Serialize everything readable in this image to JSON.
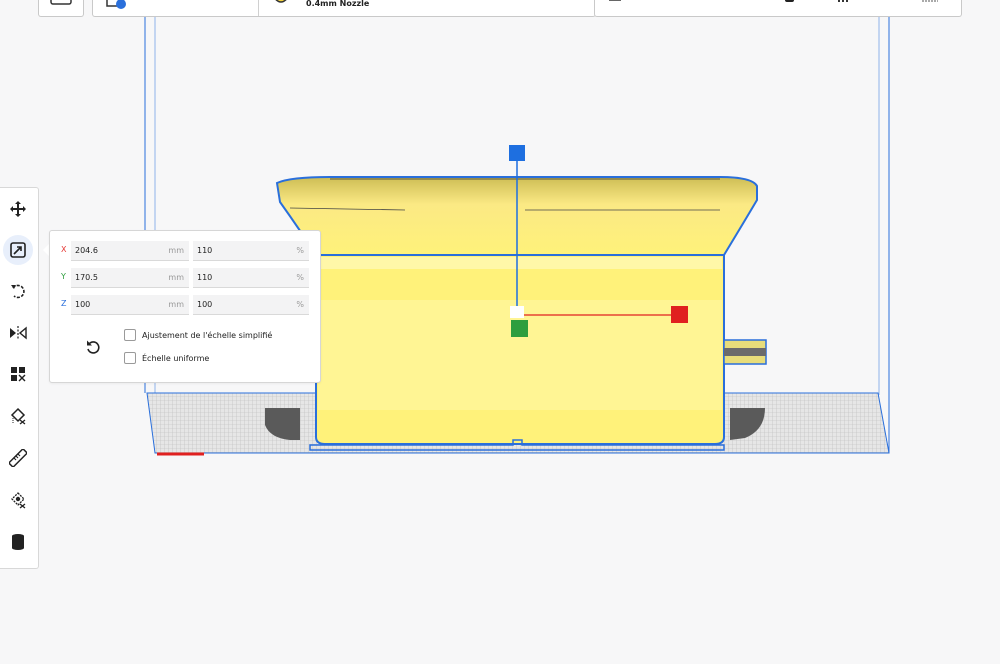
{
  "header": {
    "nozzle_label": "0.4mm Nozzle"
  },
  "toolbar": {
    "tools": [
      "move",
      "scale",
      "rotate",
      "mirror",
      "arrange",
      "support-blocker",
      "measure",
      "per-model-settings",
      "support"
    ],
    "active": "scale"
  },
  "scale_panel": {
    "rows": [
      {
        "axis": "X",
        "axis_color": "#e53935",
        "size": "204.6",
        "size_unit": "mm",
        "percent": "110",
        "percent_unit": "%"
      },
      {
        "axis": "Y",
        "axis_color": "#2e9e3e",
        "size": "170.5",
        "size_unit": "mm",
        "percent": "110",
        "percent_unit": "%"
      },
      {
        "axis": "Z",
        "axis_color": "#2a6fdb",
        "size": "100",
        "size_unit": "mm",
        "percent": "100",
        "percent_unit": "%"
      }
    ],
    "snap_scaling_label": "Ajustement de l'échelle simplifié",
    "snap_scaling_checked": false,
    "uniform_scaling_label": "Échelle uniforme",
    "uniform_scaling_checked": false
  },
  "colors": {
    "model": "#fff27a",
    "selection_outline": "#2a6fdb",
    "x_handle": "#e02020",
    "y_handle": "#2e9e3e",
    "z_handle": "#1e6fe0"
  }
}
